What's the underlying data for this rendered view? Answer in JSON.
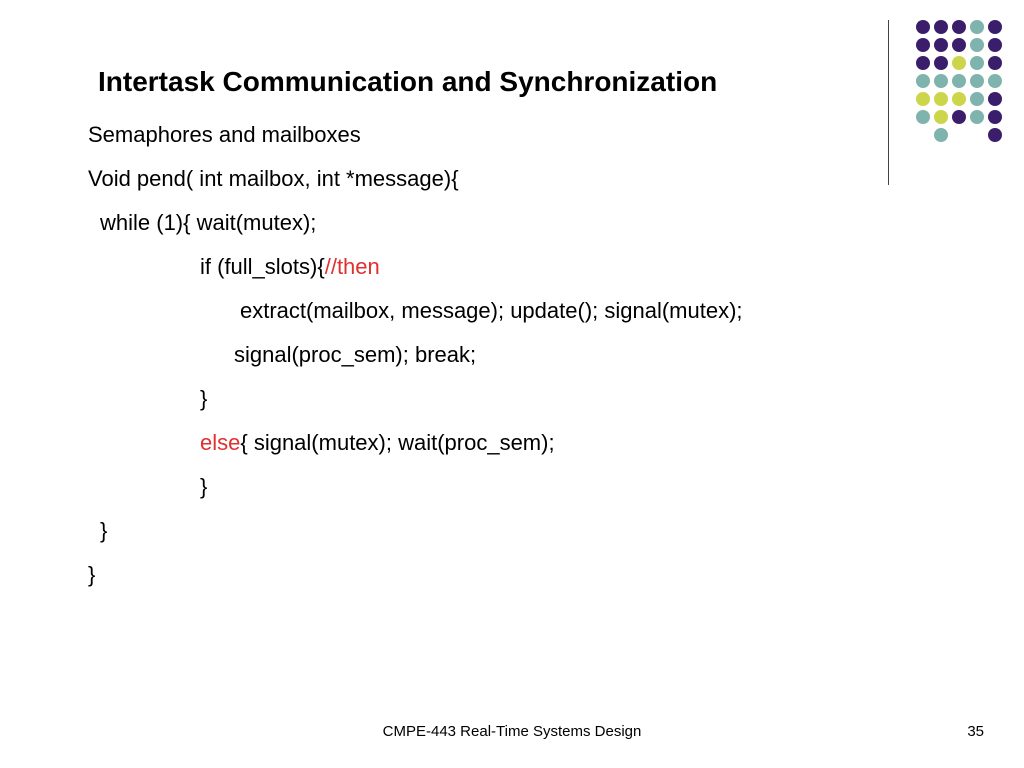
{
  "title": "Intertask Communication and Synchronization",
  "lines": [
    {
      "indent": 0,
      "segs": [
        {
          "t": "Semaphores and mailboxes"
        }
      ]
    },
    {
      "indent": 0,
      "segs": [
        {
          "t": "Void pend( int mailbox, int *message){"
        }
      ]
    },
    {
      "indent": 12,
      "segs": [
        {
          "t": "while (1){ wait(mutex);"
        }
      ]
    },
    {
      "indent": 112,
      "segs": [
        {
          "t": "if (full_slots){"
        },
        {
          "t": "//then",
          "c": "red"
        }
      ]
    },
    {
      "indent": 152,
      "segs": [
        {
          "t": "extract(mailbox, message); update(); signal(mutex);"
        }
      ]
    },
    {
      "indent": 146,
      "segs": [
        {
          "t": "signal(proc_sem); break;"
        }
      ]
    },
    {
      "indent": 112,
      "segs": [
        {
          "t": "}"
        }
      ]
    },
    {
      "indent": 112,
      "segs": [
        {
          "t": "else",
          "c": "red"
        },
        {
          "t": "{ signal(mutex); wait(proc_sem);"
        }
      ]
    },
    {
      "indent": 112,
      "segs": [
        {
          "t": "}"
        }
      ]
    },
    {
      "indent": 12,
      "segs": [
        {
          "t": "}"
        }
      ]
    },
    {
      "indent": 0,
      "segs": [
        {
          "t": "}"
        }
      ]
    }
  ],
  "footer": "CMPE-443 Real-Time Systems Design",
  "page": "35",
  "colors": {
    "purple": "#3b1e6b",
    "teal": "#7fb3ae",
    "olive": "#cdd54a"
  },
  "dot_rows": [
    [
      "purple",
      "purple",
      "purple",
      "teal",
      "purple"
    ],
    [
      "purple",
      "purple",
      "purple",
      "teal",
      "purple"
    ],
    [
      "purple",
      "purple",
      "olive",
      "teal",
      "purple"
    ],
    [
      "teal",
      "teal",
      "teal",
      "teal",
      "teal"
    ],
    [
      "olive",
      "olive",
      "olive",
      "teal",
      "purple"
    ],
    [
      "teal",
      "olive",
      "purple",
      "teal",
      "purple"
    ],
    [
      "",
      "teal",
      "",
      "",
      "purple"
    ]
  ]
}
